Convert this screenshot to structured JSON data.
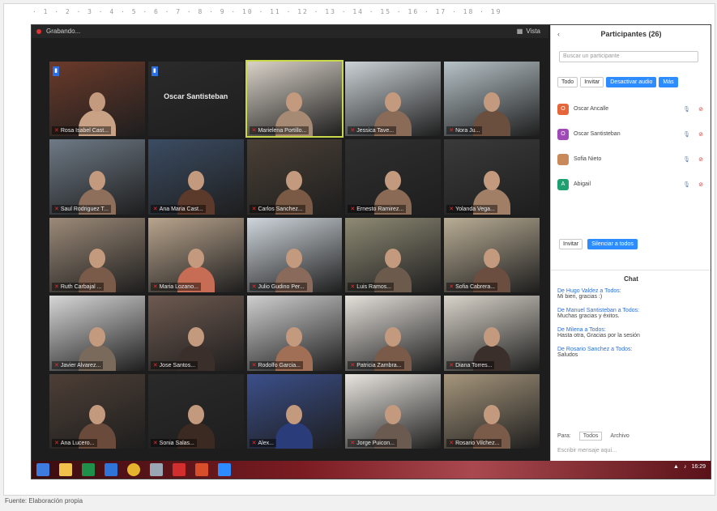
{
  "ruler_text": "· 1 · 2 · 3 · 4 · 5 · 6 · 7 · 8 · 9 · 10 · 11 · 12 · 13 · 14 · 15 · 16 · 17 · 18 · 19 ·",
  "zoom": {
    "top_left_label": "Grabando...",
    "top_right_label": "Vista"
  },
  "tiles": [
    {
      "name": "Rosa Isabel Cast...",
      "active": false,
      "badge": true,
      "bigname": ""
    },
    {
      "name": "",
      "active": false,
      "badge": true,
      "bigname": "Oscar Santisteban"
    },
    {
      "name": "Marielena Portillo...",
      "active": true,
      "badge": false,
      "bigname": ""
    },
    {
      "name": "Jessica Tave...",
      "active": false,
      "badge": false,
      "bigname": ""
    },
    {
      "name": "Nora Ju...",
      "active": false,
      "badge": false,
      "bigname": ""
    },
    {
      "name": "Saul Rodriguez T...",
      "active": false,
      "badge": false,
      "bigname": ""
    },
    {
      "name": "Ana Maria Cast...",
      "active": false,
      "badge": false,
      "bigname": ""
    },
    {
      "name": "Carlos Sanchez...",
      "active": false,
      "badge": false,
      "bigname": ""
    },
    {
      "name": "Ernesto Ramirez...",
      "active": false,
      "badge": false,
      "bigname": ""
    },
    {
      "name": "Yolanda Vega...",
      "active": false,
      "badge": false,
      "bigname": ""
    },
    {
      "name": "Ruth Carbajal ...",
      "active": false,
      "badge": false,
      "bigname": ""
    },
    {
      "name": "Maria Lozano...",
      "active": false,
      "badge": false,
      "bigname": ""
    },
    {
      "name": "Julio Gudino Per...",
      "active": false,
      "badge": false,
      "bigname": ""
    },
    {
      "name": "Luis Ramos...",
      "active": false,
      "badge": false,
      "bigname": ""
    },
    {
      "name": "Sofia Cabrera...",
      "active": false,
      "badge": false,
      "bigname": ""
    },
    {
      "name": "Javier Alvarez...",
      "active": false,
      "badge": false,
      "bigname": ""
    },
    {
      "name": "Jose Santos...",
      "active": false,
      "badge": false,
      "bigname": ""
    },
    {
      "name": "Rodolfo Garcia...",
      "active": false,
      "badge": false,
      "bigname": ""
    },
    {
      "name": "Patricia Zambra...",
      "active": false,
      "badge": false,
      "bigname": ""
    },
    {
      "name": "Diana Torres...",
      "active": false,
      "badge": false,
      "bigname": ""
    },
    {
      "name": "Ana Lucero...",
      "active": false,
      "badge": false,
      "bigname": ""
    },
    {
      "name": "Sonia Salas...",
      "active": false,
      "badge": false,
      "bigname": ""
    },
    {
      "name": "Alex...",
      "active": false,
      "badge": false,
      "bigname": ""
    },
    {
      "name": "Jorge Puicon...",
      "active": false,
      "badge": false,
      "bigname": ""
    },
    {
      "name": "Rosario Vilchez...",
      "active": false,
      "badge": false,
      "bigname": ""
    }
  ],
  "panel": {
    "title": "Participantes (26)",
    "search_placeholder": "Buscar un participante",
    "buttons": [
      "Todo",
      "Invitar",
      "Desactivar audio",
      "Más"
    ],
    "participants": [
      {
        "initial": "O",
        "name": "Oscar Ancalle",
        "color": "#e4663a"
      },
      {
        "initial": "O",
        "name": "Oscar Santisteban",
        "color": "#a04ab8"
      },
      {
        "initial": "",
        "name": "Sofia Nieto",
        "color": "#c98a5b"
      },
      {
        "initial": "A",
        "name": "Abigail",
        "color": "#20a070"
      }
    ],
    "actions": [
      "Invitar",
      "Silenciar a todos"
    ],
    "chat_title": "Chat",
    "messages": [
      {
        "from": "De Hugo Valdez a Todos:",
        "text": "Mi bien, gracias :)"
      },
      {
        "from": "De Manuel Santisteban a Todos:",
        "text": "Muchas gracias y éxitos."
      },
      {
        "from": "De Milena a Todos:",
        "text": "Hasta otra, Gracias por la sesión"
      },
      {
        "from": "De Rosario Sanchez a Todos:",
        "text": "Saludos"
      }
    ],
    "to_label": "Para:",
    "to_value": "Todos",
    "file_label": "Archivo",
    "input_placeholder": "Escribir mensaje aquí..."
  },
  "caption": "Fuente: Elaboración propia",
  "taskbar_clock": "16:29"
}
